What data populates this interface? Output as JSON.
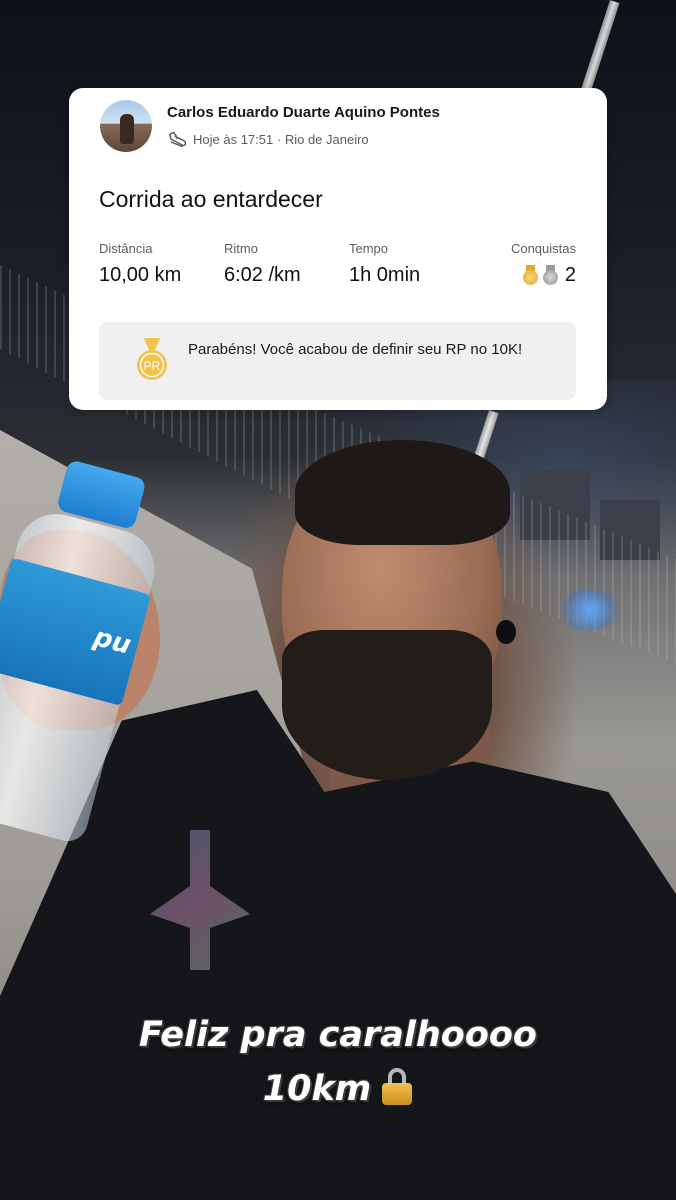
{
  "activity": {
    "user_name": "Carlos Eduardo Duarte Aquino Pontes",
    "timestamp": "Hoje às 17:51",
    "separator": "·",
    "location": "Rio de Janeiro",
    "title": "Corrida ao entardecer",
    "stats": {
      "distance": {
        "label": "Distância",
        "value": "10,00 km"
      },
      "pace": {
        "label": "Ritmo",
        "value": "6:02 /km"
      },
      "time": {
        "label": "Tempo",
        "value": "1h 0min"
      },
      "achievements": {
        "label": "Conquistas",
        "count": "2",
        "medals": [
          "gold-medal-icon",
          "silver-medal-icon"
        ]
      }
    },
    "pr": {
      "badge": "PR",
      "message": "Parabéns! Você acabou de definir seu RP no 10K!"
    }
  },
  "caption": {
    "line1": "Feliz pra caralhoooo",
    "line2": "10km",
    "emoji": "lock-icon"
  },
  "bottle_label": "pu",
  "colors": {
    "card_bg": "#ffffff",
    "pr_box_bg": "#f0f0f0",
    "gold": "#f2c14e",
    "silver": "#a6a6a6",
    "bottle_blue": "#1f7ed0"
  }
}
